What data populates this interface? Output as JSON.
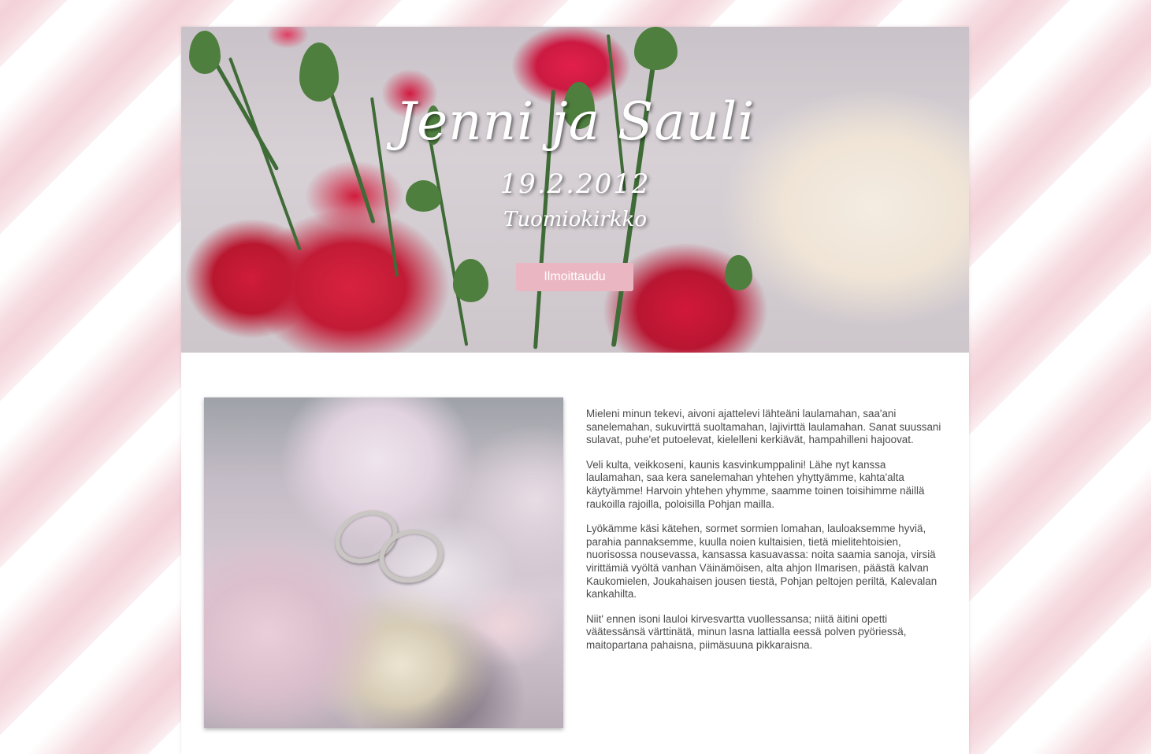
{
  "hero": {
    "title": "Jenni ja Sauli",
    "date": "19.2.2012",
    "venue": "Tuomiokirkko",
    "signup_label": "Ilmoittaudu"
  },
  "content": {
    "paragraphs": [
      "Mieleni minun tekevi, aivoni ajattelevi lähteäni laulamahan, saa'ani sanelemahan, sukuvirttä suoltamahan, lajivirttä laulamahan. Sanat suussani sulavat, puhe'et putoelevat, kielelleni kerkiävät, hampahilleni hajoovat.",
      "Veli kulta, veikkoseni, kaunis kasvinkumppalini! Lähe nyt kanssa laulamahan, saa kera sanelemahan yhtehen yhyttyämme, kahta'alta käytyämme! Harvoin yhtehen yhymme, saamme toinen toisihimme näillä raukoilla rajoilla, poloisilla Pohjan mailla.",
      "Lyökämme käsi kätehen, sormet sormien lomahan, lauloaksemme hyviä, parahia pannaksemme, kuulla noien kultaisien, tietä mielitehtoisien, nuorisossa nousevassa, kansassa kasuavassa: noita saamia sanoja, virsiä virittämiä vyöltä vanhan Väinämöisen, alta ahjon Ilmarisen, päästä kalvan Kaukomielen, Joukahaisen jousen tiestä, Pohjan peltojen periltä, Kalevalan kankahilta.",
      "Niit' ennen isoni lauloi kirvesvartta vuollessansa; niitä äitini opetti väätessänsä värttinätä, minun lasna lattialla eessä polven pyöriessä, maitopartana pahaisna, piimäsuuna pikkaraisna."
    ]
  },
  "colors": {
    "accent": "#eab6c1",
    "text": "#4a4a4a",
    "stripe": "#f3d2d8"
  }
}
